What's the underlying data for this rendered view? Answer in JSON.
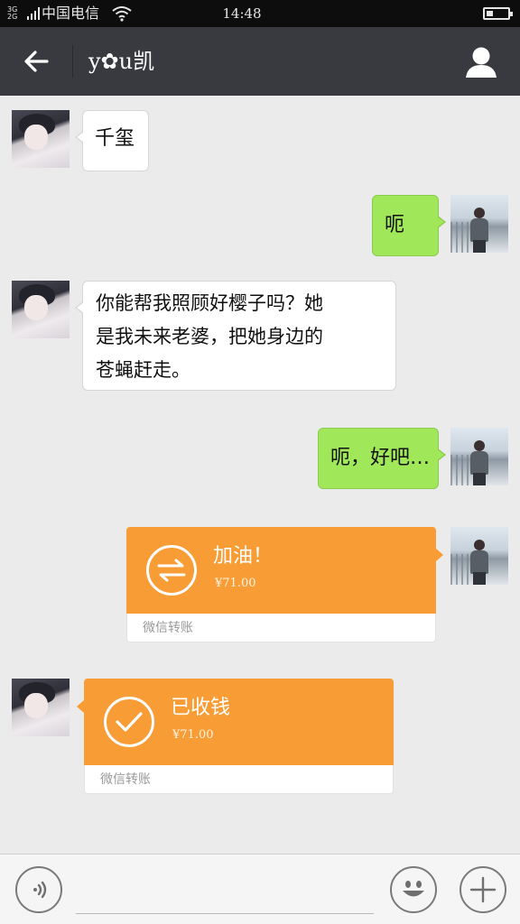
{
  "status_bar": {
    "network_top": "3G",
    "network_bottom": "2G",
    "carrier": "中国电信",
    "time": "14:48",
    "battery_level": 0.3
  },
  "header": {
    "back_icon": "arrow-left-icon",
    "title": "y✿u凯",
    "profile_icon": "person-icon"
  },
  "messages": [
    {
      "side": "in",
      "text": "千玺"
    },
    {
      "side": "out",
      "text": "呃"
    },
    {
      "side": "in",
      "lines": [
        "你能帮我照顾好樱子吗？她",
        "是我未来老婆，把她身边的",
        "苍蝇赶走。"
      ]
    },
    {
      "side": "out",
      "text": "呃，好吧…"
    }
  ],
  "transfers": [
    {
      "side": "out",
      "title": "加油！",
      "amount": "¥71.00",
      "label": "微信转账",
      "icon": "transfer-arrows-icon"
    },
    {
      "side": "in",
      "title": "已收钱",
      "amount": "¥71.00",
      "label": "微信转账",
      "icon": "checkmark-icon"
    }
  ],
  "input_bar": {
    "voice_icon": "voice-icon",
    "emoji_icon": "smiley-icon",
    "plus_icon": "plus-icon",
    "input_value": ""
  },
  "colors": {
    "header_bg": "#393a3f",
    "chat_bg": "#ebebeb",
    "outgoing_bubble": "#a0e75a",
    "transfer_orange": "#f89c35"
  }
}
